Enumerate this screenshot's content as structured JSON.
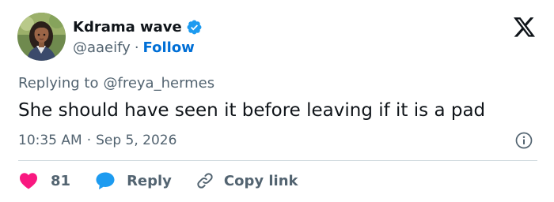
{
  "author": {
    "display_name": "Kdrama wave",
    "handle": "@aaeify",
    "separator": "·",
    "follow_label": "Follow",
    "verified_color": "#1d9bf0"
  },
  "reply_context": {
    "prefix": "Replying to",
    "mention": "@freya_hermes"
  },
  "tweet": {
    "text": "She should have seen it before leaving if it is a pad",
    "time": "10:35 AM",
    "separator": "·",
    "date": "Sep 5, 2026"
  },
  "actions": {
    "like_count": "81",
    "reply_label": "Reply",
    "copy_link_label": "Copy link"
  },
  "icons": {
    "brand": "x-logo-icon",
    "verified": "verified-badge-icon",
    "info": "info-icon",
    "like": "heart-icon",
    "reply": "speech-bubble-icon",
    "copy": "link-icon"
  },
  "colors": {
    "text": "#0f1419",
    "secondary": "#536471",
    "link": "#006fd6",
    "heart": "#f91880",
    "reply_bubble": "#1d9bf0",
    "divider": "#cfd9de"
  }
}
